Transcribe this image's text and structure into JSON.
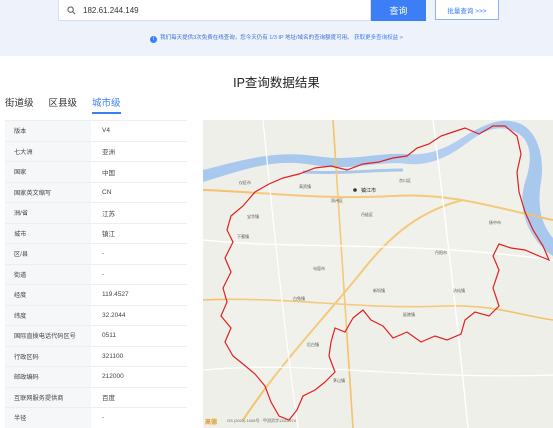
{
  "search": {
    "value": "182.61.244.149",
    "query_label": "查询",
    "bulk_label": "批量查询 >>>"
  },
  "notice": {
    "prefix": "我们每天提供3次免费在线查询，您今天仍有",
    "remaining": "1/3",
    "middle": "IP 地址/域名的查询额度可用。",
    "link": "获取更多查询权益 >"
  },
  "result_title": "IP查询数据结果",
  "tabs": [
    "街道级",
    "区县级",
    "城市级"
  ],
  "table": [
    {
      "k": "版本",
      "v": "V4"
    },
    {
      "k": "七大洲",
      "v": "亚洲"
    },
    {
      "k": "国家",
      "v": "中国"
    },
    {
      "k": "国家英文缩写",
      "v": "CN"
    },
    {
      "k": "洲/省",
      "v": "江苏"
    },
    {
      "k": "城市",
      "v": "镇江"
    },
    {
      "k": "区/县",
      "v": "-"
    },
    {
      "k": "街道",
      "v": "-"
    },
    {
      "k": "经度",
      "v": "119.4527"
    },
    {
      "k": "纬度",
      "v": "32.2044"
    },
    {
      "k": "国际直拨电话代码区号",
      "v": "0511"
    },
    {
      "k": "行政区码",
      "v": "321100"
    },
    {
      "k": "邮政编码",
      "v": "212000"
    },
    {
      "k": "互联网服务提供商",
      "v": "百度"
    },
    {
      "k": "半径",
      "v": "-"
    }
  ],
  "map": {
    "city_label": "镇江市",
    "places": [
      "丹徒区",
      "句容市",
      "扬中市",
      "丹阳市",
      "京口区",
      "润州区",
      "宝华镇",
      "下蜀镇",
      "白兔镇",
      "延陵镇",
      "访仙镇",
      "新坝镇",
      "后白镇",
      "茅山镇",
      "高资镇",
      "仪征市"
    ],
    "copyright": "GS (2025) 1008号 · 甲测资字11110574",
    "logo": "高德"
  },
  "colors": {
    "accent": "#3b7ef5",
    "boundary": "#e02020",
    "river": "#a9c8ee",
    "road": "#f3c26a"
  }
}
